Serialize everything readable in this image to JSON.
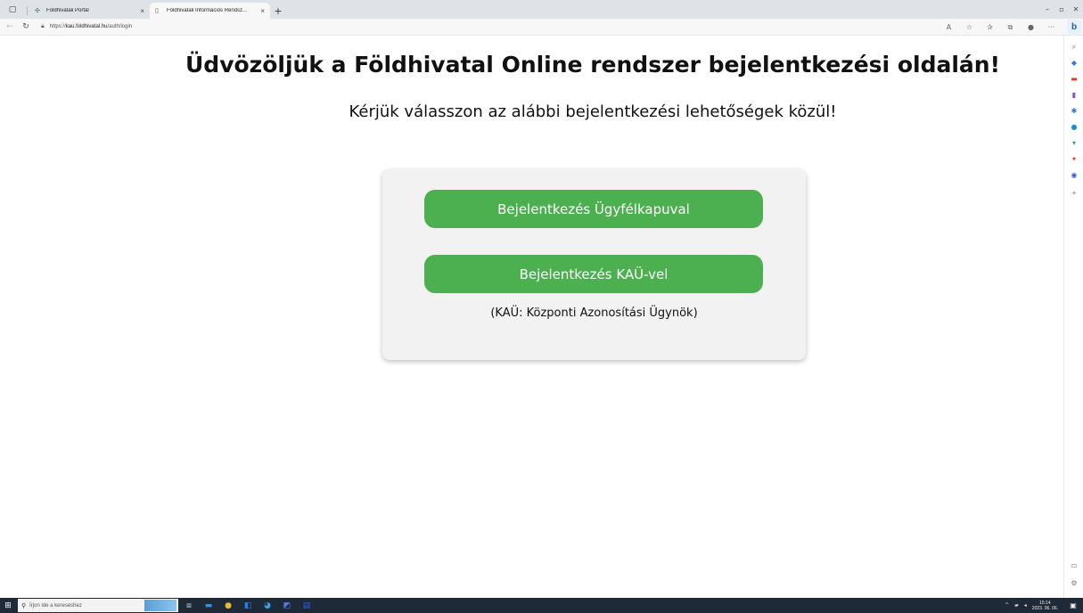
{
  "browser": {
    "tabs": [
      {
        "label": "Földhivatali Portál",
        "icon": "leaf-icon",
        "active": false
      },
      {
        "label": "Földhivatali Információs Rendsz...",
        "icon": "page-icon",
        "active": true
      }
    ],
    "close_glyph": "×",
    "new_tab_glyph": "+",
    "url_scheme": "https://",
    "url_host": "kau.foldhivatal.hu",
    "url_path": "/auth/login",
    "bing_label": "b"
  },
  "page": {
    "title": "Üdvözöljük a Földhivatal Online rendszer bejelentkezési oldalán!",
    "subtitle": "Kérjük válasszon az alábbi bejelentkezési lehetőségek közül!",
    "login_ugyfelkapu_label": "Bejelentkezés Ügyfélkapuval",
    "login_kau_label": "Bejelentkezés KAÜ-vel",
    "kau_note": "(KAÜ: Központi Azonosítási Ügynök)"
  },
  "taskbar": {
    "search_placeholder": "Írjon ide a kereséshez",
    "time": "15:14",
    "date": "2023. 06. 06."
  },
  "colors": {
    "button_green": "#4caf50",
    "card_bg": "#f2f2f2",
    "taskbar_bg": "#1f2a38"
  }
}
